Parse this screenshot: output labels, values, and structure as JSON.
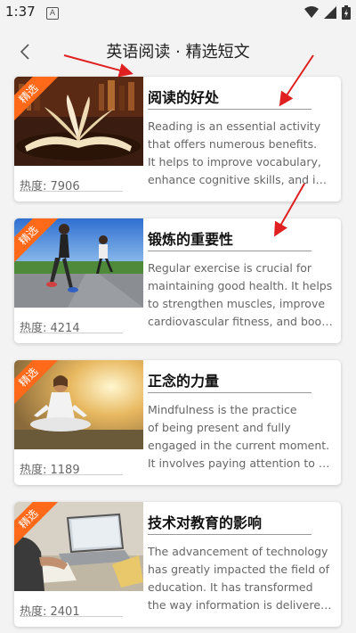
{
  "status": {
    "time": "1:37",
    "notif_letter": "A"
  },
  "header": {
    "title": "英语阅读 · 精选短文"
  },
  "badge_label": "精选",
  "accent_color": "#ff6a1a",
  "articles": [
    {
      "title": "阅读的好处",
      "heat": "热度: 7906",
      "lines": [
        "Reading is an essential activity",
        "that offers numerous benefits.",
        "It helps to improve vocabulary,",
        "enhance cognitive skills, and incr…"
      ],
      "image": "open-book-image"
    },
    {
      "title": "锻炼的重要性",
      "heat": "热度: 4214",
      "lines": [
        "Regular exercise is crucial for",
        "maintaining good health. It helps",
        "to strengthen muscles, improve",
        "cardiovascular fitness, and boos…"
      ],
      "image": "runners-image"
    },
    {
      "title": "正念的力量",
      "heat": "热度: 1189",
      "lines": [
        "Mindfulness is the practice",
        "of being present and fully",
        "engaged in the current moment.",
        "It involves paying attention to th…"
      ],
      "image": "meditation-image"
    },
    {
      "title": "技术对教育的影响",
      "heat": "热度: 2401",
      "lines": [
        "The advancement of technology",
        "has greatly impacted the field of",
        "education. It has transformed",
        "the way information is delivered …"
      ],
      "image": "laptop-study-image"
    }
  ]
}
